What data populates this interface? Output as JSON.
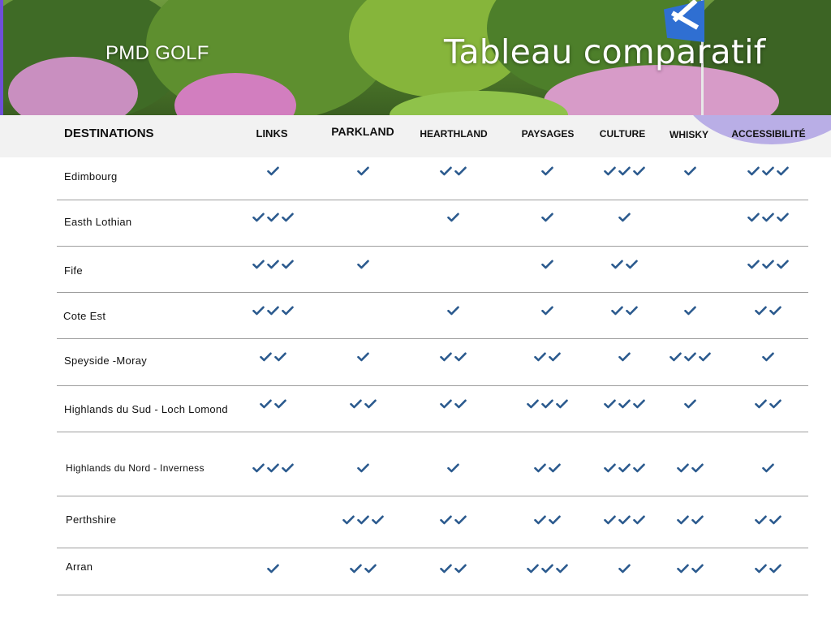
{
  "brand": "PMD GOLF",
  "title": "Tableau comparatif",
  "columns": [
    {
      "key": "destinations",
      "label": "DESTINATIONS"
    },
    {
      "key": "links",
      "label": "LINKS"
    },
    {
      "key": "parkland",
      "label": "PARKLAND"
    },
    {
      "key": "hearthland",
      "label": "HEARTHLAND"
    },
    {
      "key": "paysages",
      "label": "PAYSAGES"
    },
    {
      "key": "culture",
      "label": "CULTURE"
    },
    {
      "key": "whisky",
      "label": "WHISKY"
    },
    {
      "key": "accessibilite",
      "label": "ACCESSIBILITÉ"
    }
  ],
  "rows": [
    {
      "name": "Edimbourg",
      "ratings": [
        1,
        1,
        2,
        1,
        3,
        1,
        3
      ]
    },
    {
      "name": "Easth Lothian",
      "ratings": [
        3,
        0,
        1,
        1,
        1,
        0,
        3
      ]
    },
    {
      "name": "Fife",
      "ratings": [
        3,
        1,
        0,
        1,
        2,
        0,
        3
      ]
    },
    {
      "name": "Cote Est",
      "ratings": [
        3,
        0,
        1,
        1,
        2,
        1,
        2
      ]
    },
    {
      "name": "Speyside -Moray",
      "ratings": [
        2,
        1,
        2,
        2,
        1,
        3,
        1
      ]
    },
    {
      "name": "Highlands du Sud - Loch Lomond",
      "ratings": [
        2,
        2,
        2,
        3,
        3,
        1,
        2
      ]
    },
    {
      "name": "Highlands du Nord - Inverness",
      "ratings": [
        3,
        1,
        1,
        2,
        3,
        2,
        1
      ]
    },
    {
      "name": "Perthshire",
      "ratings": [
        0,
        3,
        2,
        2,
        3,
        2,
        2
      ]
    },
    {
      "name": "Arran",
      "ratings": [
        1,
        2,
        2,
        3,
        1,
        2,
        2
      ]
    }
  ],
  "icons": {
    "rating": "check-icon"
  },
  "colors": {
    "check": "#2b5a8e",
    "header_bg": "#f2f2f2",
    "accent_arc": "#b9aee6",
    "divider": "#9e9e9e"
  }
}
